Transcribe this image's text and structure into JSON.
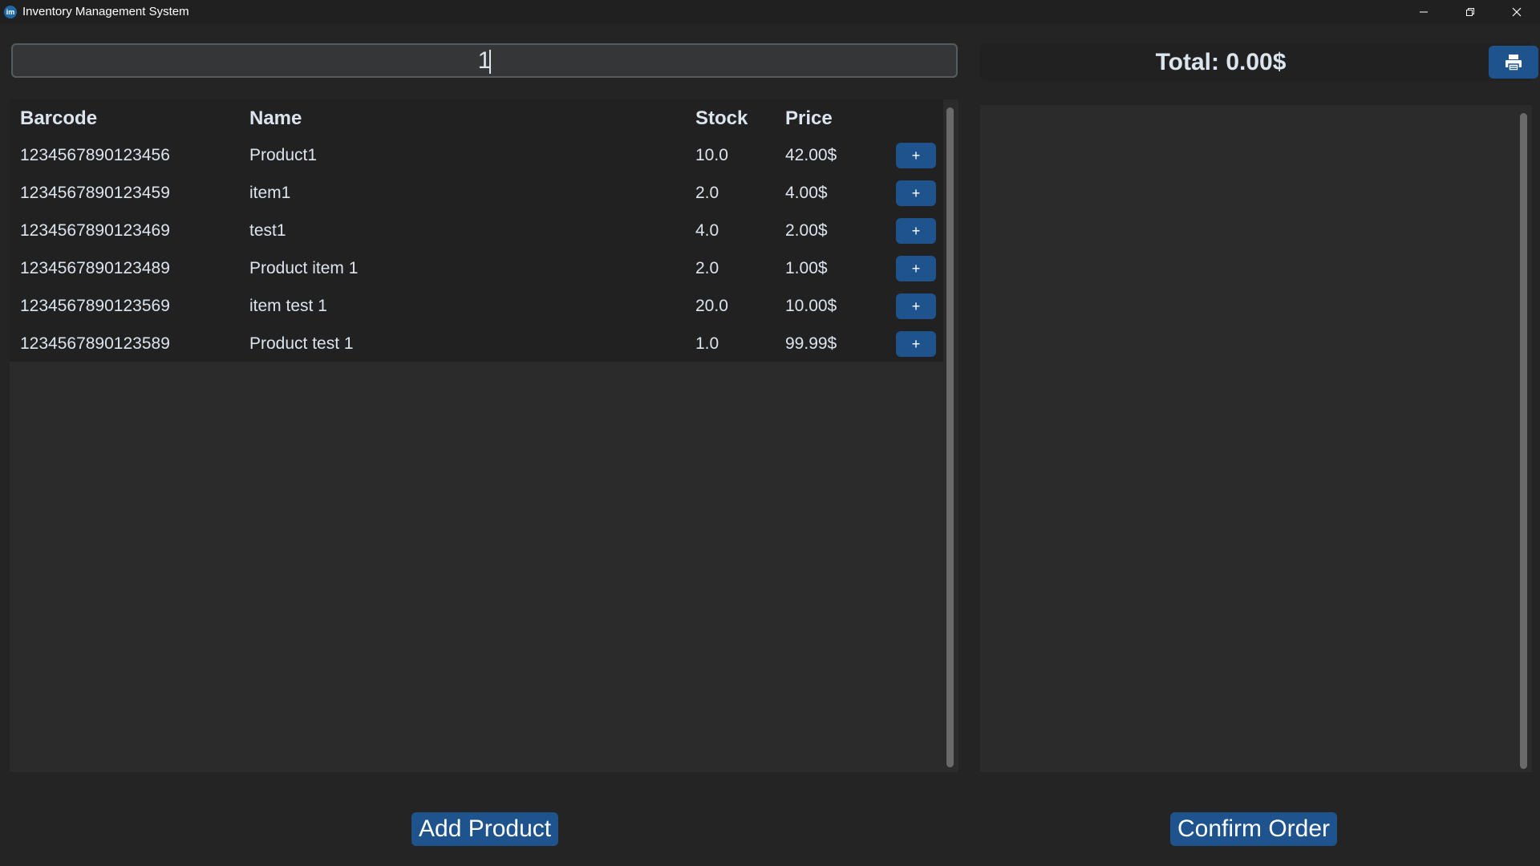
{
  "window": {
    "icon_text": "im",
    "title": "Inventory Management System"
  },
  "search": {
    "value": "1"
  },
  "table": {
    "headers": [
      "Barcode",
      "Name",
      "Stock",
      "Price"
    ],
    "rows": [
      {
        "barcode": "1234567890123456",
        "name": "Product1",
        "stock": "10.0",
        "price": "42.00$",
        "add": "+"
      },
      {
        "barcode": "1234567890123459",
        "name": "item1",
        "stock": "2.0",
        "price": "4.00$",
        "add": "+"
      },
      {
        "barcode": "1234567890123469",
        "name": "test1",
        "stock": "4.0",
        "price": "2.00$",
        "add": "+"
      },
      {
        "barcode": "1234567890123489",
        "name": "Product item 1",
        "stock": "2.0",
        "price": "1.00$",
        "add": "+"
      },
      {
        "barcode": "1234567890123569",
        "name": "item test 1",
        "stock": "20.0",
        "price": "10.00$",
        "add": "+"
      },
      {
        "barcode": "1234567890123589",
        "name": "Product test 1",
        "stock": "1.0",
        "price": "99.99$",
        "add": "+"
      }
    ]
  },
  "order": {
    "total_label": "Total: 0.00$"
  },
  "buttons": {
    "add_product": "Add Product",
    "confirm_order": "Confirm Order"
  },
  "colors": {
    "accent": "#1f538d",
    "background": "#242424"
  }
}
